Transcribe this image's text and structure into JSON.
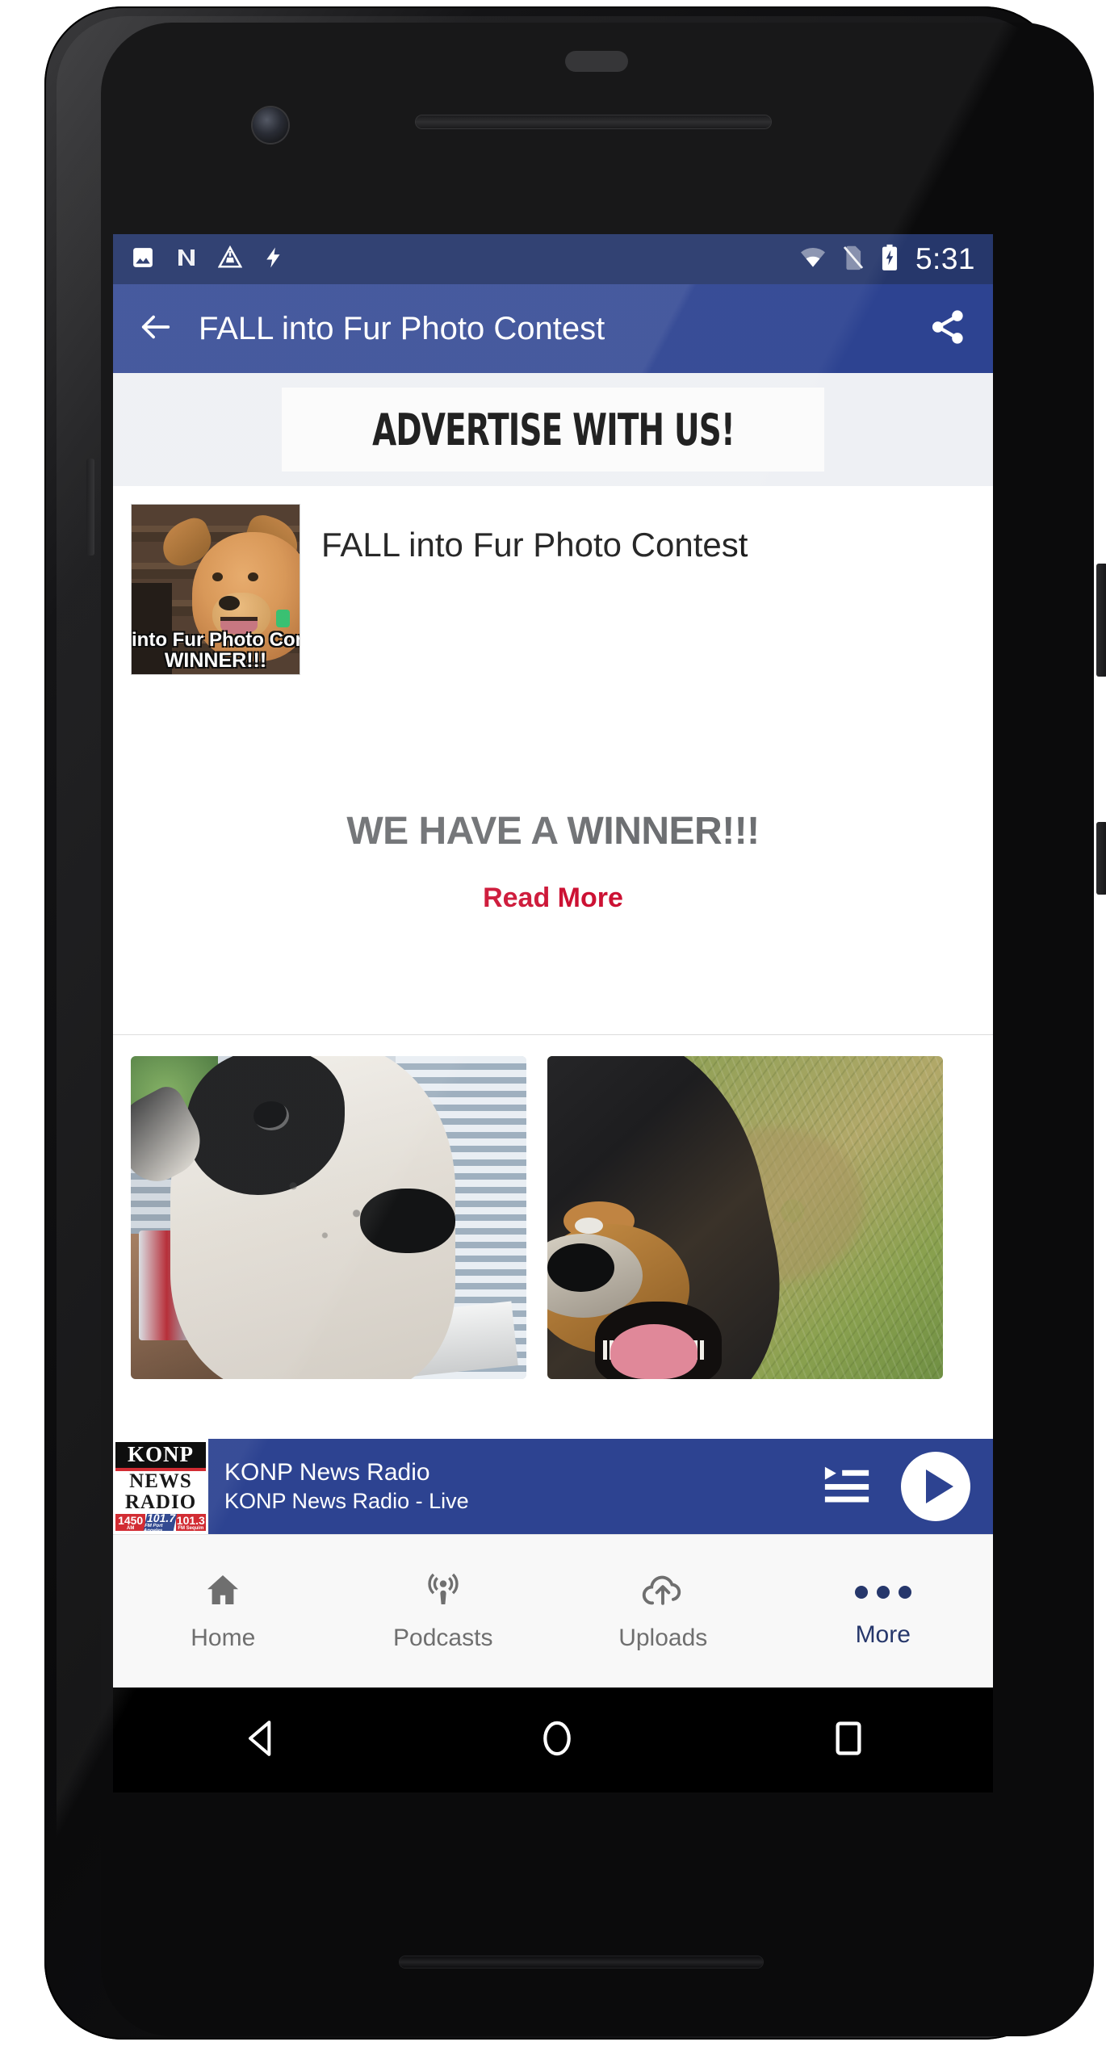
{
  "status_bar": {
    "icons_left": [
      "photo-icon",
      "nova-launcher-icon",
      "work-in-progress-icon",
      "flash-icon"
    ],
    "icons_right": [
      "wifi-icon",
      "no-sim-icon",
      "battery-charging-icon"
    ],
    "clock": "5:31"
  },
  "app_bar": {
    "back_label": "back-arrow",
    "title": "FALL into Fur Photo Contest",
    "share_label": "share"
  },
  "ad_banner": {
    "text": "ADVERTISE WITH US!"
  },
  "article": {
    "title": "FALL into Fur Photo Contest",
    "thumbnail_overlay_line1": "into Fur Photo Con",
    "thumbnail_overlay_line2": "WINNER!!!",
    "winner_line": "WE HAVE A WINNER!!!",
    "read_more": "Read More"
  },
  "photos": [
    {
      "alt": "black and white dog close up indoors"
    },
    {
      "alt": "black and tan dog rolling in grass"
    }
  ],
  "player": {
    "artwork": {
      "call_letters": "KONP",
      "line2": "NEWS",
      "line3": "RADIO",
      "frequencies": [
        {
          "number": "1450",
          "sub": "AM"
        },
        {
          "number": "101.7",
          "sub": "FM Port Angeles"
        },
        {
          "number": "101.3",
          "sub": "FM Sequim"
        }
      ]
    },
    "title": "KONP News Radio",
    "subtitle": "KONP News Radio - Live",
    "queue_label": "queue",
    "play_label": "play"
  },
  "bottom_nav": {
    "items": [
      {
        "label": "Home",
        "icon": "home-icon",
        "active": false
      },
      {
        "label": "Podcasts",
        "icon": "podcast-icon",
        "active": false
      },
      {
        "label": "Uploads",
        "icon": "cloud-upload-icon",
        "active": false
      },
      {
        "label": "More",
        "icon": "more-dots-icon",
        "active": true
      }
    ]
  },
  "android_nav": {
    "back": "back-triangle-icon",
    "home": "home-circle-icon",
    "recents": "recents-square-icon"
  },
  "colors": {
    "status_bar": "#26376b",
    "app_bar": "#2d4391",
    "accent_red": "#cc1133",
    "winner_gray": "#6d6f72",
    "nav_active": "#26376b"
  }
}
